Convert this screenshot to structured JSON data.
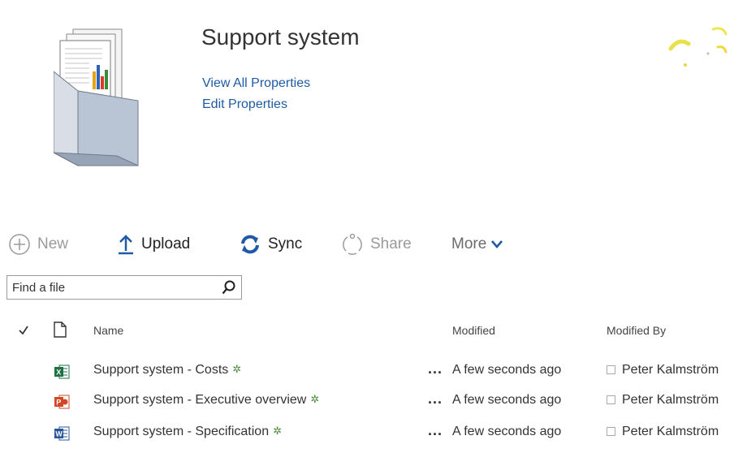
{
  "header": {
    "title": "Support system",
    "view_all_properties": "View All Properties",
    "edit_properties": "Edit Properties",
    "icon": "document-set-icon"
  },
  "toolbar": {
    "new_label": "New",
    "upload_label": "Upload",
    "sync_label": "Sync",
    "share_label": "Share",
    "more_label": "More"
  },
  "search": {
    "placeholder": "Find a file"
  },
  "list": {
    "columns": {
      "name": "Name",
      "modified": "Modified",
      "modified_by": "Modified By"
    },
    "rows": [
      {
        "name": "Support system - Costs",
        "modified": "A few seconds ago",
        "modified_by": "Peter Kalmström",
        "file_type": "excel"
      },
      {
        "name": "Support system - Executive overview",
        "modified": "A few seconds ago",
        "modified_by": "Peter Kalmström",
        "file_type": "powerpoint"
      },
      {
        "name": "Support system - Specification",
        "modified": "A few seconds ago",
        "modified_by": "Peter Kalmström",
        "file_type": "word"
      }
    ]
  },
  "colors": {
    "link": "#1f5aa6",
    "disabled": "#9a9a9a",
    "excel": "#1e7145",
    "powerpoint": "#d24726",
    "word": "#2b579a",
    "new_marker": "#4f8a3c"
  }
}
